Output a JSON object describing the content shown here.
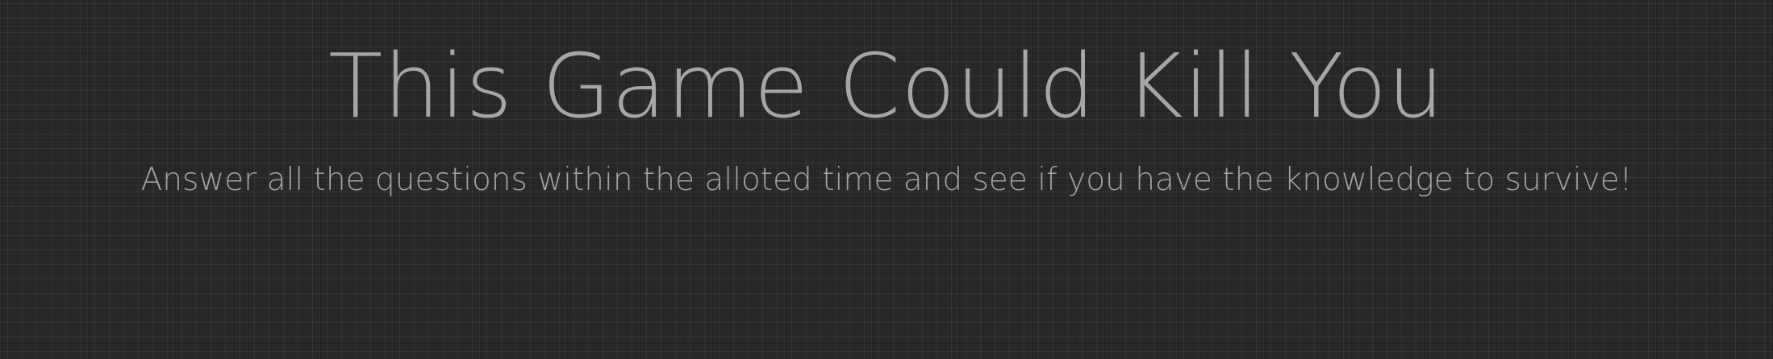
{
  "start_screen": {
    "title": "This Game Could Kill You",
    "subtitle": "Answer all the questions within the alloted time and see if you have the knowledge to survive!"
  },
  "colors": {
    "background": "#282828",
    "text": "#a6a6a6"
  }
}
